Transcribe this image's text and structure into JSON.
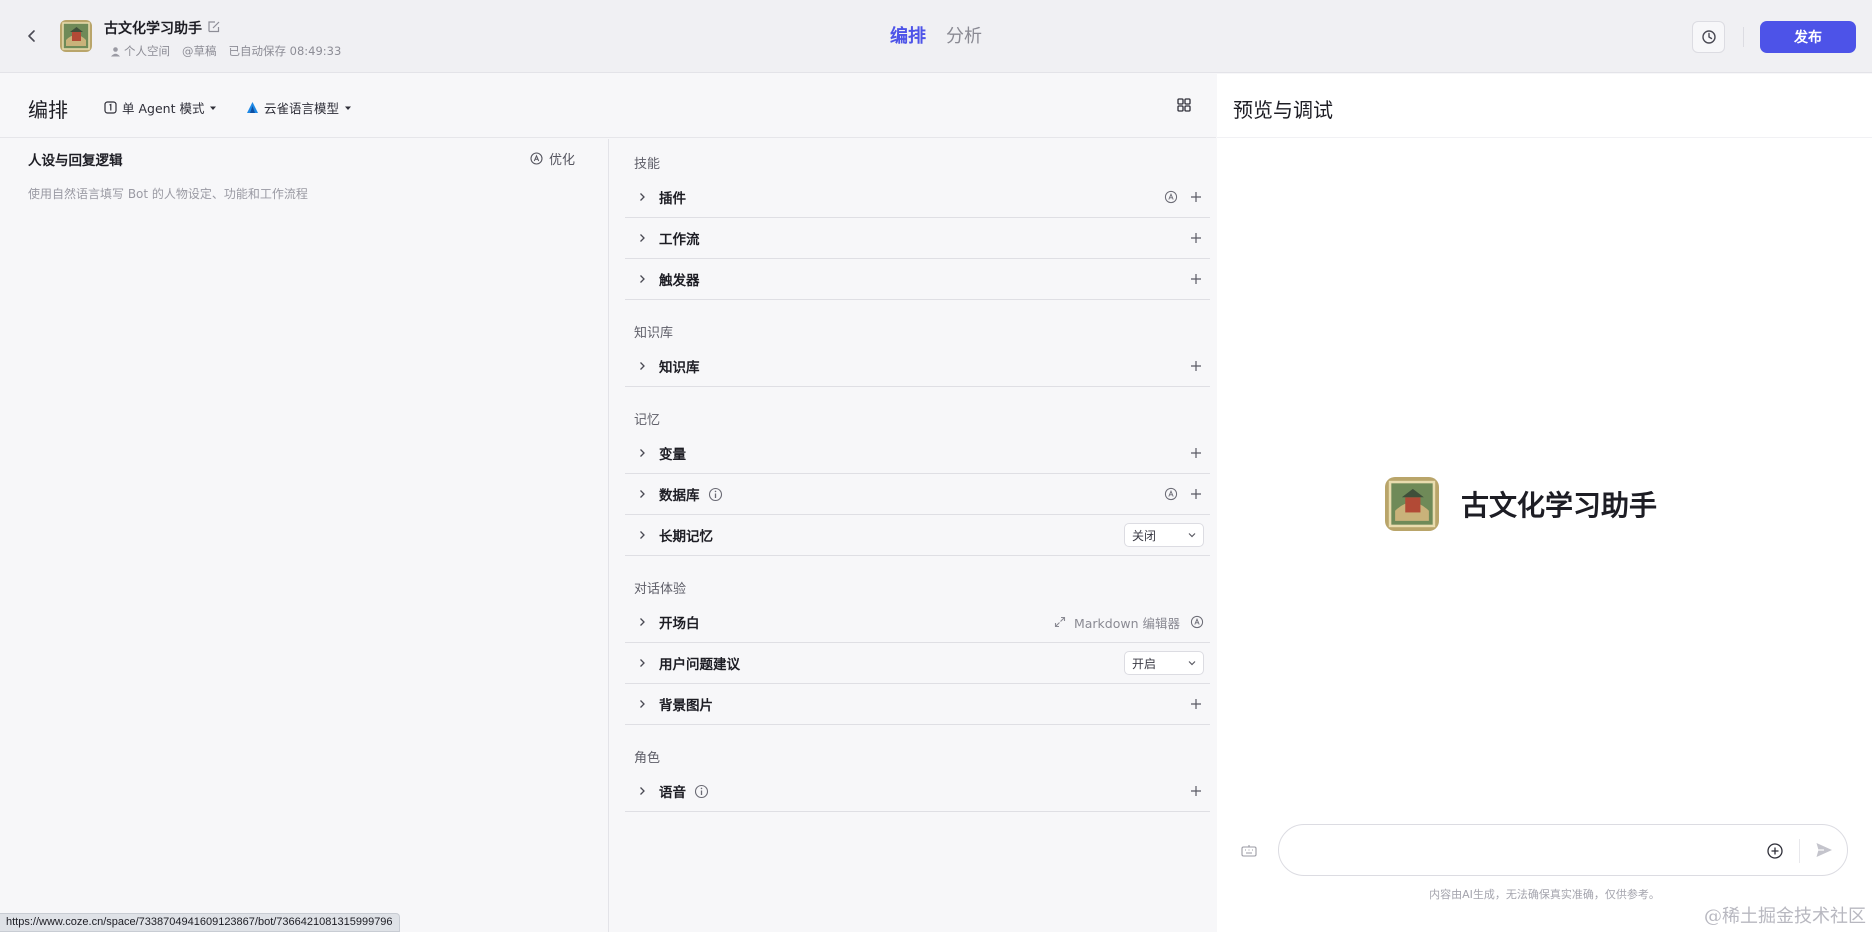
{
  "header": {
    "bot_name": "古文化学习助手",
    "workspace": "个人空间",
    "draft": "@草稿",
    "autosave": "已自动保存 08:49:33",
    "tabs": [
      {
        "label": "编排",
        "active": true
      },
      {
        "label": "分析",
        "active": false
      }
    ],
    "publish_label": "发布"
  },
  "toolbar": {
    "title": "编排",
    "mode_label": "单 Agent 模式",
    "model_label": "云雀语言模型"
  },
  "prompt": {
    "title": "人设与回复逻辑",
    "optimize_label": "优化",
    "placeholder": "使用自然语言填写 Bot 的人物设定、功能和工作流程"
  },
  "skills": {
    "sections": [
      {
        "title": "技能",
        "rows": [
          {
            "label": "插件"
          },
          {
            "label": "工作流"
          },
          {
            "label": "触发器"
          }
        ]
      },
      {
        "title": "知识库",
        "rows": [
          {
            "label": "知识库"
          }
        ]
      },
      {
        "title": "记忆",
        "rows": [
          {
            "label": "变量"
          },
          {
            "label": "数据库"
          },
          {
            "label": "长期记忆",
            "select_value": "关闭"
          }
        ]
      },
      {
        "title": "对话体验",
        "rows": [
          {
            "label": "开场白",
            "extra": "Markdown 编辑器"
          },
          {
            "label": "用户问题建议",
            "select_value": "开启"
          },
          {
            "label": "背景图片"
          }
        ]
      },
      {
        "title": "角色",
        "rows": [
          {
            "label": "语音"
          }
        ]
      }
    ]
  },
  "preview": {
    "title": "预览与调试",
    "bot_name": "古文化学习助手",
    "input_placeholder": "",
    "disclaimer": "内容由AI生成，无法确保真实准确，仅供参考。"
  },
  "overlay": {
    "status_url": "https://www.coze.cn/space/7338704941609123867/bot/7366421081315999796",
    "watermark": "@稀土掘金技术社区"
  },
  "colors": {
    "accent": "#4d53e8",
    "text_primary": "#1d1d24",
    "text_secondary": "#8d8d96",
    "background": "#f7f7f9"
  }
}
